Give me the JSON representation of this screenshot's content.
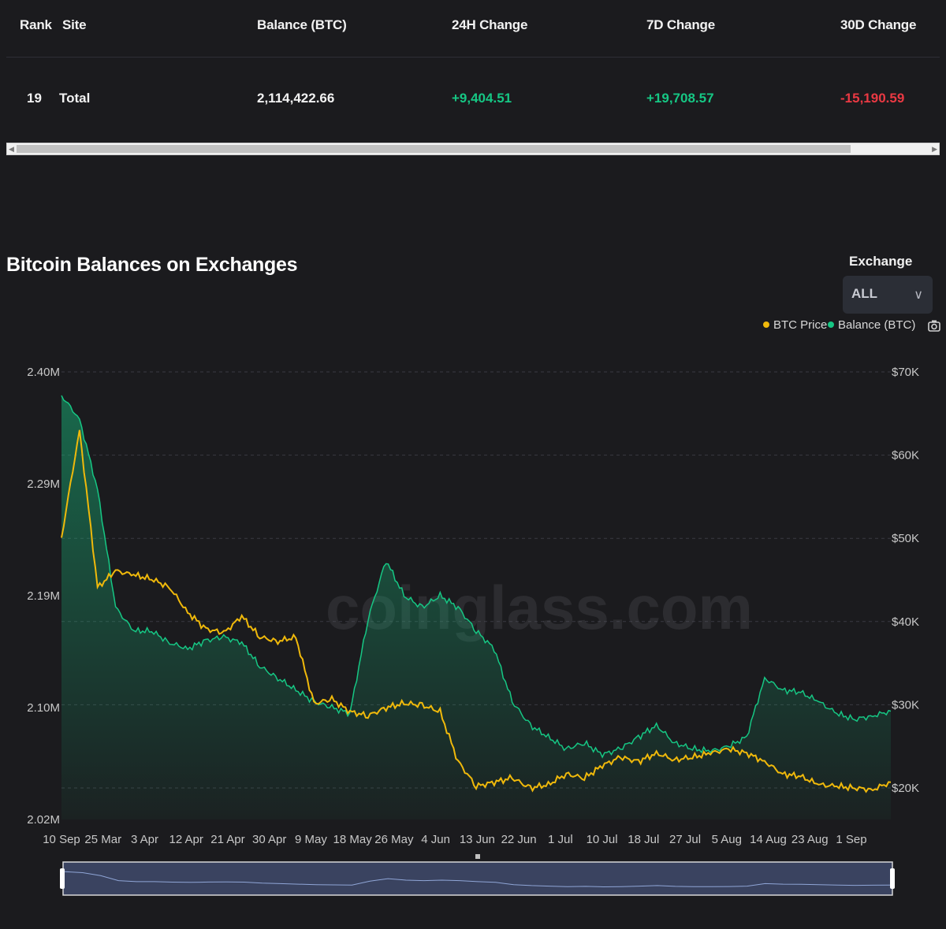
{
  "table": {
    "headers": [
      "Rank",
      "Site",
      "Balance (BTC)",
      "24H Change",
      "7D Change",
      "30D Change"
    ],
    "row": {
      "rank": "19",
      "site": "Total",
      "balance": "2,114,422.66",
      "change_24h": "+9,404.51",
      "change_7d": "+19,708.57",
      "change_30d": "-15,190.59"
    }
  },
  "chart_section": {
    "title": "Bitcoin Balances on Exchanges",
    "exchange_label": "Exchange",
    "exchange_value": "ALL",
    "legend": [
      {
        "name": "BTC Price",
        "color": "#f0b90b"
      },
      {
        "name": "Balance (BTC)",
        "color": "#16c784"
      }
    ],
    "watermark": "coinglass.com",
    "camera_icon": "camera-icon"
  },
  "chart_data": {
    "type": "line",
    "x": [
      "10 Sep",
      "25 Mar",
      "3 Apr",
      "12 Apr",
      "21 Apr",
      "30 Apr",
      "9 May",
      "18 May",
      "26 May",
      "4 Jun",
      "13 Jun",
      "22 Jun",
      "1 Jul",
      "10 Jul",
      "18 Jul",
      "27 Jul",
      "5 Aug",
      "14 Aug",
      "23 Aug",
      "1 Sep"
    ],
    "y_left_ticks": [
      "2.40M",
      "2.29M",
      "2.19M",
      "2.10M",
      "2.02M"
    ],
    "y_right_ticks": [
      "$70K",
      "$60K",
      "$50K",
      "$40K",
      "$30K",
      "$20K"
    ],
    "ylim_left": [
      2020000,
      2400000
    ],
    "ylim_right": [
      16000,
      70000
    ],
    "series": [
      {
        "name": "Balance (BTC)",
        "axis": "left",
        "values": [
          2380000,
          2360000,
          2300000,
          2200000,
          2180000,
          2180000,
          2170000,
          2165000,
          2172000,
          2175000,
          2170000,
          2150000,
          2140000,
          2130000,
          2120000,
          2115000,
          2110000,
          2190000,
          2240000,
          2210000,
          2200000,
          2210000,
          2200000,
          2180000,
          2165000,
          2120000,
          2100000,
          2090000,
          2080000,
          2085000,
          2075000,
          2080000,
          2090000,
          2100000,
          2085000,
          2080000,
          2078000,
          2082000,
          2090000,
          2140000,
          2130000,
          2128000,
          2120000,
          2110000,
          2105000,
          2108000,
          2112000
        ]
      },
      {
        "name": "BTC Price",
        "axis": "right",
        "values": [
          50000,
          63000,
          44000,
          46000,
          45500,
          45000,
          44000,
          41000,
          39000,
          38500,
          40500,
          38000,
          37500,
          38000,
          30000,
          30500,
          29000,
          28500,
          29500,
          30000,
          29800,
          29000,
          23000,
          20000,
          20500,
          21000,
          19800,
          20200,
          21500,
          21000,
          22500,
          23500,
          23000,
          24000,
          23200,
          23500,
          24000,
          24500,
          24000,
          23000,
          21500,
          21200,
          20200,
          20000,
          19800,
          19600,
          20500
        ]
      }
    ],
    "grid": true,
    "legend_position": "top-right"
  }
}
